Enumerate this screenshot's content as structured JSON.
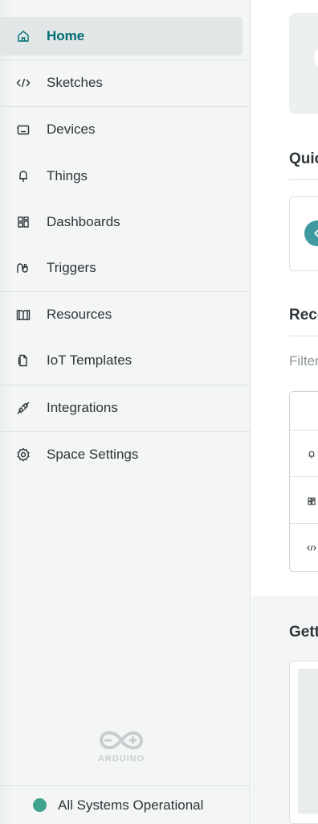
{
  "sidebar": {
    "items": [
      {
        "label": "Home",
        "icon": "home-icon"
      },
      {
        "label": "Sketches",
        "icon": "code-icon"
      },
      {
        "label": "Devices",
        "icon": "device-icon"
      },
      {
        "label": "Things",
        "icon": "thing-icon"
      },
      {
        "label": "Dashboards",
        "icon": "dashboard-icon"
      },
      {
        "label": "Triggers",
        "icon": "trigger-icon"
      },
      {
        "label": "Resources",
        "icon": "book-icon"
      },
      {
        "label": "IoT Templates",
        "icon": "template-icon"
      },
      {
        "label": "Integrations",
        "icon": "plug-icon"
      },
      {
        "label": "Space Settings",
        "icon": "gear-icon"
      }
    ],
    "active_index": 0,
    "logo_text": "ARDUINO",
    "status": {
      "label": "All Systems Operational",
      "color": "#3fa38e"
    }
  },
  "main": {
    "quick_title": "Quic",
    "recent_title": "Rece",
    "filter_placeholder": "Filter",
    "getting_title": "Gett"
  },
  "colors": {
    "accent": "#006d73",
    "teal_icon": "#3f9aa0"
  }
}
